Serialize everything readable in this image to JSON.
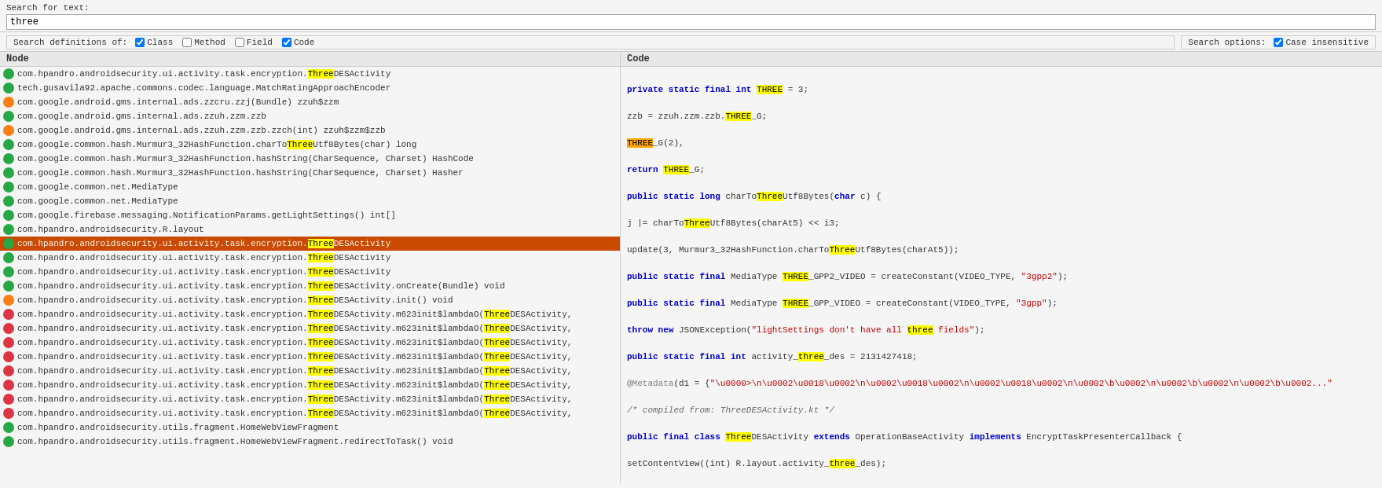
{
  "search": {
    "label": "Search for text:",
    "value": "three",
    "placeholder": ""
  },
  "definitions": {
    "label": "Search definitions of:",
    "options": [
      {
        "label": "Class",
        "checked": true
      },
      {
        "label": "Method",
        "checked": false
      },
      {
        "label": "Field",
        "checked": false
      },
      {
        "label": "Code",
        "checked": true
      }
    ]
  },
  "search_options": {
    "label": "Search options:",
    "options": [
      {
        "label": "Case insensitive",
        "checked": true
      }
    ]
  },
  "node_panel": {
    "header": "Node"
  },
  "code_panel": {
    "header": "Code"
  },
  "nodes": [
    {
      "icon": "green",
      "text": "com.hpandro.androidsecurity.ui.activity.task.encryption.ThreeDESActivity",
      "selected": false
    },
    {
      "icon": "green",
      "text": "tech.gusavila92.apache.commons.codec.language.MatchRatingApproachEncoder",
      "selected": false
    },
    {
      "icon": "orange",
      "text": "com.google.android.gms.internal.ads.zzcru.zzj(Bundle) zzuh$zzm",
      "selected": false
    },
    {
      "icon": "green",
      "text": "com.google.android.gms.internal.ads.zzuh.zzm.zzb",
      "selected": false
    },
    {
      "icon": "orange",
      "text": "com.google.android.gms.internal.ads.zzuh.zzm.zzb.zzch(int) zzuh$zzm$zzb",
      "selected": false
    },
    {
      "icon": "green",
      "text": "com.google.common.hash.Murmur3_32HashFunction.charToThreeUtf8Bytes(char) long",
      "selected": false
    },
    {
      "icon": "green",
      "text": "com.google.common.hash.Murmur3_32HashFunction.hashString(CharSequence, Charset) HashCode",
      "selected": false
    },
    {
      "icon": "green",
      "text": "com.google.common.hash.Murmur3_32HashFunction.hashString(CharSequence, Charset) Hasher",
      "selected": false
    },
    {
      "icon": "green",
      "text": "com.google.common.net.MediaType",
      "selected": false
    },
    {
      "icon": "green",
      "text": "com.google.common.net.MediaType",
      "selected": false
    },
    {
      "icon": "green",
      "text": "com.google.firebase.messaging.NotificationParams.getLightSettings() int[]",
      "selected": false
    },
    {
      "icon": "green",
      "text": "com.hpandro.androidsecurity.R.layout",
      "selected": false
    },
    {
      "icon": "green",
      "text": "com.hpandro.androidsecurity.ui.activity.task.encryption.ThreeDESActivity",
      "selected": true
    },
    {
      "icon": "green",
      "text": "com.hpandro.androidsecurity.ui.activity.task.encryption.ThreeDESActivity",
      "selected": false
    },
    {
      "icon": "green",
      "text": "com.hpandro.androidsecurity.ui.activity.task.encryption.ThreeDESActivity",
      "selected": false
    },
    {
      "icon": "green",
      "text": "com.hpandro.androidsecurity.ui.activity.task.encryption.ThreeDESActivity.onCreate(Bundle) void",
      "selected": false
    },
    {
      "icon": "orange",
      "text": "com.hpandro.androidsecurity.ui.activity.task.encryption.ThreeDESActivity.init() void",
      "selected": false
    },
    {
      "icon": "red",
      "text": "com.hpandro.androidsecurity.ui.activity.task.encryption.ThreeDESActivity.m623init$lambdaO(ThreeDESActivity,",
      "selected": false
    },
    {
      "icon": "red",
      "text": "com.hpandro.androidsecurity.ui.activity.task.encryption.ThreeDESActivity.m623init$lambdaO(ThreeDESActivity,",
      "selected": false
    },
    {
      "icon": "red",
      "text": "com.hpandro.androidsecurity.ui.activity.task.encryption.ThreeDESActivity.m623init$lambdaO(ThreeDESActivity,",
      "selected": false
    },
    {
      "icon": "red",
      "text": "com.hpandro.androidsecurity.ui.activity.task.encryption.ThreeDESActivity.m623init$lambdaO(ThreeDESActivity,",
      "selected": false
    },
    {
      "icon": "red",
      "text": "com.hpandro.androidsecurity.ui.activity.task.encryption.ThreeDESActivity.m623init$lambdaO(ThreeDESActivity,",
      "selected": false
    },
    {
      "icon": "red",
      "text": "com.hpandro.androidsecurity.ui.activity.task.encryption.ThreeDESActivity.m623init$lambdaO(ThreeDESActivity,",
      "selected": false
    },
    {
      "icon": "red",
      "text": "com.hpandro.androidsecurity.ui.activity.task.encryption.ThreeDESActivity.m623init$lambdaO(ThreeDESActivity,",
      "selected": false
    },
    {
      "icon": "red",
      "text": "com.hpandro.androidsecurity.ui.activity.task.encryption.ThreeDESActivity.m623init$lambdaO(ThreeDESActivity,",
      "selected": false
    },
    {
      "icon": "green",
      "text": "com.hpandro.androidsecurity.utils.fragment.HomeWebViewFragment",
      "selected": false
    },
    {
      "icon": "green",
      "text": "com.hpandro.androidsecurity.utils.fragment.HomeWebViewFragment.redirectToTask() void",
      "selected": false
    }
  ]
}
